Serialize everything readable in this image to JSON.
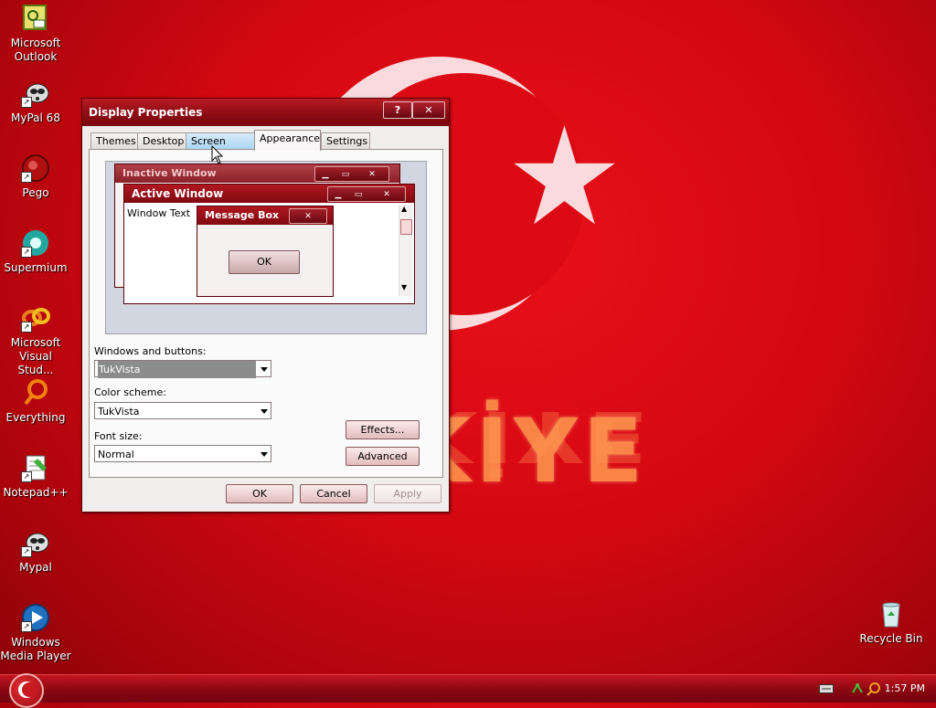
{
  "wallpaper": {
    "text": "KİYE",
    "reflection_text": "TÜRKİYE"
  },
  "desktop_icons": [
    {
      "label": "Microsoft Outlook",
      "icon": "outlook-icon"
    },
    {
      "label": "MyPal 68",
      "icon": "mypal-icon"
    },
    {
      "label": "Pego",
      "icon": "pego-icon"
    },
    {
      "label": "Supermium",
      "icon": "supermium-icon"
    },
    {
      "label": "Microsoft Visual Stud...",
      "icon": "visual-studio-icon"
    },
    {
      "label": "Everything",
      "icon": "everything-icon"
    },
    {
      "label": "Notepad++",
      "icon": "notepadpp-icon"
    },
    {
      "label": "Mypal",
      "icon": "mypal-icon"
    },
    {
      "label": "Windows Media Player",
      "icon": "media-player-icon"
    },
    {
      "label": "Recycle Bin",
      "icon": "recycle-bin-icon"
    }
  ],
  "dialog": {
    "title": "Display Properties",
    "help_glyph": "?",
    "close_glyph": "✕",
    "tabs": [
      "Themes",
      "Desktop",
      "Screen Saver",
      "Appearance",
      "Settings"
    ],
    "active_tab": "Appearance",
    "preview": {
      "inactive_title": "Inactive Window",
      "active_title": "Active Window",
      "window_text": "Window Text",
      "message_title": "Message Box",
      "message_ok": "OK"
    },
    "windows_buttons_label": "Windows and buttons:",
    "windows_buttons_value": "TukVista",
    "color_scheme_label": "Color scheme:",
    "color_scheme_value": "TukVista",
    "font_size_label": "Font size:",
    "font_size_value": "Normal",
    "effects_label": "Effects...",
    "advanced_label": "Advanced",
    "ok_label": "OK",
    "cancel_label": "Cancel",
    "apply_label": "Apply"
  },
  "taskbar": {
    "clock": "1:57 PM"
  },
  "colors": {
    "accent": "#8a0c14",
    "desktop": "#d40812"
  }
}
